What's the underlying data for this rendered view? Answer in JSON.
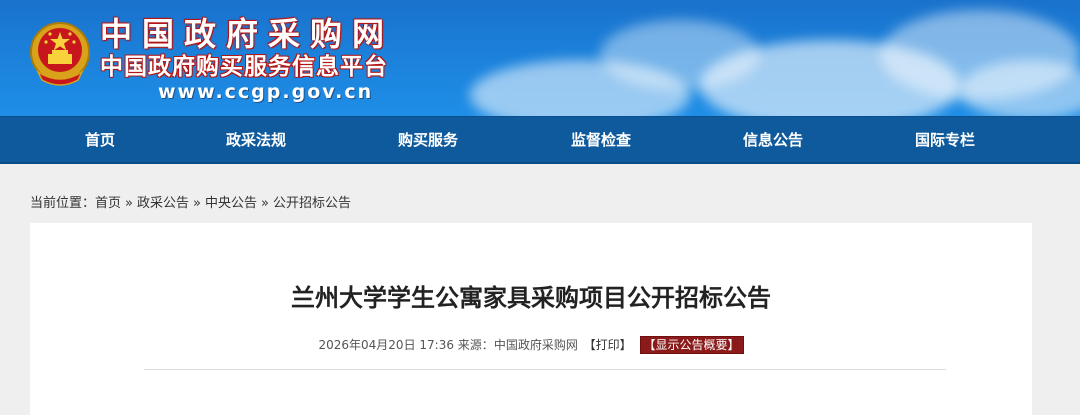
{
  "header": {
    "title_main": "中国政府采购网",
    "title_sub": "中国政府购买服务信息平台",
    "url": "www.ccgp.gov.cn",
    "emblem_icon": "national-emblem-icon"
  },
  "nav": {
    "items": [
      {
        "label": "首页"
      },
      {
        "label": "政采法规"
      },
      {
        "label": "购买服务"
      },
      {
        "label": "监督检查"
      },
      {
        "label": "信息公告"
      },
      {
        "label": "国际专栏"
      }
    ]
  },
  "breadcrumb": {
    "prefix": "当前位置：",
    "items": [
      "首页",
      "政采公告",
      "中央公告",
      "公开招标公告"
    ],
    "separator": "»"
  },
  "article": {
    "title": "兰州大学学生公寓家具采购项目公开招标公告",
    "datetime": "2026年04月20日 17:36",
    "source_label": "来源：",
    "source": "中国政府采购网",
    "print_label": "【打印】",
    "summary_label": "【显示公告概要】"
  },
  "colors": {
    "banner": "#1b80da",
    "nav": "#0f5a9c",
    "summary_button": "#8b1a1a",
    "page_bg": "#efefef"
  }
}
